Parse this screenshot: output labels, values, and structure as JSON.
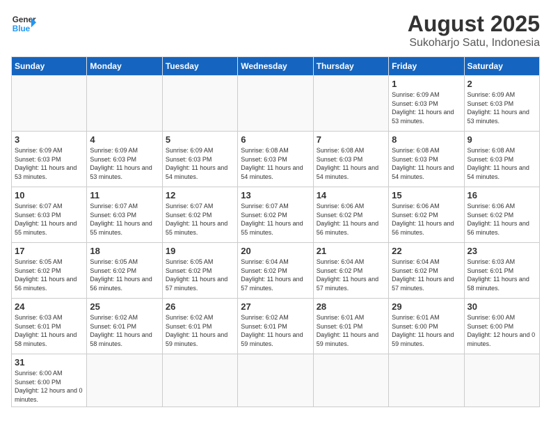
{
  "header": {
    "logo_general": "General",
    "logo_blue": "Blue",
    "title": "August 2025",
    "subtitle": "Sukoharjo Satu, Indonesia"
  },
  "weekdays": [
    "Sunday",
    "Monday",
    "Tuesday",
    "Wednesday",
    "Thursday",
    "Friday",
    "Saturday"
  ],
  "weeks": [
    [
      {
        "day": "",
        "info": ""
      },
      {
        "day": "",
        "info": ""
      },
      {
        "day": "",
        "info": ""
      },
      {
        "day": "",
        "info": ""
      },
      {
        "day": "",
        "info": ""
      },
      {
        "day": "1",
        "info": "Sunrise: 6:09 AM\nSunset: 6:03 PM\nDaylight: 11 hours\nand 53 minutes."
      },
      {
        "day": "2",
        "info": "Sunrise: 6:09 AM\nSunset: 6:03 PM\nDaylight: 11 hours\nand 53 minutes."
      }
    ],
    [
      {
        "day": "3",
        "info": "Sunrise: 6:09 AM\nSunset: 6:03 PM\nDaylight: 11 hours\nand 53 minutes."
      },
      {
        "day": "4",
        "info": "Sunrise: 6:09 AM\nSunset: 6:03 PM\nDaylight: 11 hours\nand 53 minutes."
      },
      {
        "day": "5",
        "info": "Sunrise: 6:09 AM\nSunset: 6:03 PM\nDaylight: 11 hours\nand 54 minutes."
      },
      {
        "day": "6",
        "info": "Sunrise: 6:08 AM\nSunset: 6:03 PM\nDaylight: 11 hours\nand 54 minutes."
      },
      {
        "day": "7",
        "info": "Sunrise: 6:08 AM\nSunset: 6:03 PM\nDaylight: 11 hours\nand 54 minutes."
      },
      {
        "day": "8",
        "info": "Sunrise: 6:08 AM\nSunset: 6:03 PM\nDaylight: 11 hours\nand 54 minutes."
      },
      {
        "day": "9",
        "info": "Sunrise: 6:08 AM\nSunset: 6:03 PM\nDaylight: 11 hours\nand 54 minutes."
      }
    ],
    [
      {
        "day": "10",
        "info": "Sunrise: 6:07 AM\nSunset: 6:03 PM\nDaylight: 11 hours\nand 55 minutes."
      },
      {
        "day": "11",
        "info": "Sunrise: 6:07 AM\nSunset: 6:03 PM\nDaylight: 11 hours\nand 55 minutes."
      },
      {
        "day": "12",
        "info": "Sunrise: 6:07 AM\nSunset: 6:02 PM\nDaylight: 11 hours\nand 55 minutes."
      },
      {
        "day": "13",
        "info": "Sunrise: 6:07 AM\nSunset: 6:02 PM\nDaylight: 11 hours\nand 55 minutes."
      },
      {
        "day": "14",
        "info": "Sunrise: 6:06 AM\nSunset: 6:02 PM\nDaylight: 11 hours\nand 56 minutes."
      },
      {
        "day": "15",
        "info": "Sunrise: 6:06 AM\nSunset: 6:02 PM\nDaylight: 11 hours\nand 56 minutes."
      },
      {
        "day": "16",
        "info": "Sunrise: 6:06 AM\nSunset: 6:02 PM\nDaylight: 11 hours\nand 56 minutes."
      }
    ],
    [
      {
        "day": "17",
        "info": "Sunrise: 6:05 AM\nSunset: 6:02 PM\nDaylight: 11 hours\nand 56 minutes."
      },
      {
        "day": "18",
        "info": "Sunrise: 6:05 AM\nSunset: 6:02 PM\nDaylight: 11 hours\nand 56 minutes."
      },
      {
        "day": "19",
        "info": "Sunrise: 6:05 AM\nSunset: 6:02 PM\nDaylight: 11 hours\nand 57 minutes."
      },
      {
        "day": "20",
        "info": "Sunrise: 6:04 AM\nSunset: 6:02 PM\nDaylight: 11 hours\nand 57 minutes."
      },
      {
        "day": "21",
        "info": "Sunrise: 6:04 AM\nSunset: 6:02 PM\nDaylight: 11 hours\nand 57 minutes."
      },
      {
        "day": "22",
        "info": "Sunrise: 6:04 AM\nSunset: 6:02 PM\nDaylight: 11 hours\nand 57 minutes."
      },
      {
        "day": "23",
        "info": "Sunrise: 6:03 AM\nSunset: 6:01 PM\nDaylight: 11 hours\nand 58 minutes."
      }
    ],
    [
      {
        "day": "24",
        "info": "Sunrise: 6:03 AM\nSunset: 6:01 PM\nDaylight: 11 hours\nand 58 minutes."
      },
      {
        "day": "25",
        "info": "Sunrise: 6:02 AM\nSunset: 6:01 PM\nDaylight: 11 hours\nand 58 minutes."
      },
      {
        "day": "26",
        "info": "Sunrise: 6:02 AM\nSunset: 6:01 PM\nDaylight: 11 hours\nand 59 minutes."
      },
      {
        "day": "27",
        "info": "Sunrise: 6:02 AM\nSunset: 6:01 PM\nDaylight: 11 hours\nand 59 minutes."
      },
      {
        "day": "28",
        "info": "Sunrise: 6:01 AM\nSunset: 6:01 PM\nDaylight: 11 hours\nand 59 minutes."
      },
      {
        "day": "29",
        "info": "Sunrise: 6:01 AM\nSunset: 6:00 PM\nDaylight: 11 hours\nand 59 minutes."
      },
      {
        "day": "30",
        "info": "Sunrise: 6:00 AM\nSunset: 6:00 PM\nDaylight: 12 hours\nand 0 minutes."
      }
    ],
    [
      {
        "day": "31",
        "info": "Sunrise: 6:00 AM\nSunset: 6:00 PM\nDaylight: 12 hours\nand 0 minutes."
      },
      {
        "day": "",
        "info": ""
      },
      {
        "day": "",
        "info": ""
      },
      {
        "day": "",
        "info": ""
      },
      {
        "day": "",
        "info": ""
      },
      {
        "day": "",
        "info": ""
      },
      {
        "day": "",
        "info": ""
      }
    ]
  ]
}
